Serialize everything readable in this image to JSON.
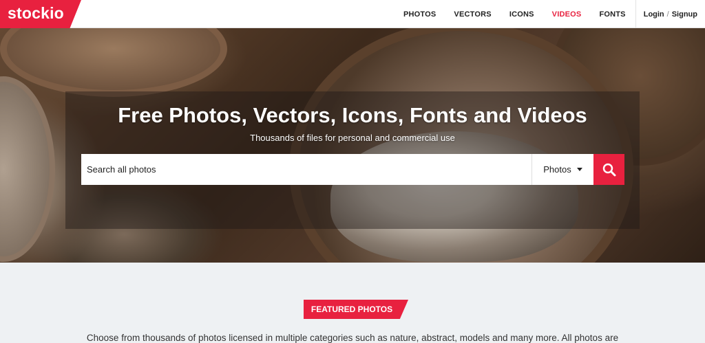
{
  "brand": {
    "logo_text": "stockio",
    "accent_color": "#e8213f"
  },
  "nav": {
    "items": [
      {
        "label": "PHOTOS",
        "active": false
      },
      {
        "label": "VECTORS",
        "active": false
      },
      {
        "label": "ICONS",
        "active": false
      },
      {
        "label": "VIDEOS",
        "active": true
      },
      {
        "label": "FONTS",
        "active": false
      }
    ],
    "login_label": "Login",
    "separator": "/",
    "signup_label": "Signup"
  },
  "hero": {
    "title": "Free Photos, Vectors, Icons, Fonts and Videos",
    "subtitle": "Thousands of files for personal and commercial use",
    "search": {
      "placeholder": "Search all photos",
      "type_selected": "Photos",
      "button_icon": "search-icon"
    }
  },
  "featured": {
    "badge": "FEATURED PHOTOS",
    "description": "Choose from thousands of photos licensed in multiple categories such as nature, abstract, models and many more. All photos are"
  }
}
